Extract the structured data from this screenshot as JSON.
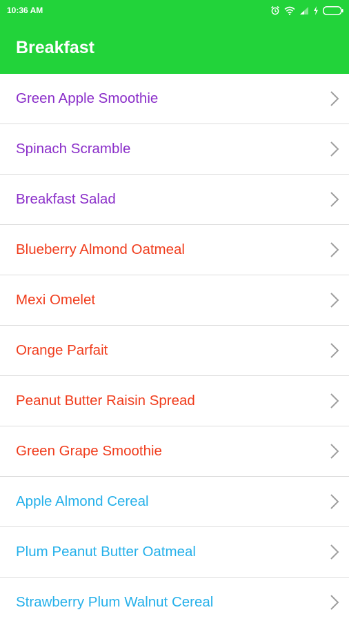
{
  "status_bar": {
    "time": "10:36 AM",
    "icons": [
      "alarm-icon",
      "wifi-icon",
      "signal-icon",
      "charging-icon",
      "battery-icon"
    ]
  },
  "app_bar": {
    "title": "Breakfast",
    "background_color": "#22d33a"
  },
  "colors": {
    "purple": "#8a2ec9",
    "red": "#f03c1c",
    "blue": "#25b0ea"
  },
  "items": [
    {
      "label": "Green Apple Smoothie",
      "color": "#8a2ec9"
    },
    {
      "label": "Spinach Scramble",
      "color": "#8a2ec9"
    },
    {
      "label": "Breakfast Salad",
      "color": "#8a2ec9"
    },
    {
      "label": "Blueberry Almond Oatmeal",
      "color": "#f03c1c"
    },
    {
      "label": "Mexi Omelet",
      "color": "#f03c1c"
    },
    {
      "label": "Orange Parfait",
      "color": "#f03c1c"
    },
    {
      "label": "Peanut Butter Raisin Spread",
      "color": "#f03c1c"
    },
    {
      "label": "Green Grape Smoothie",
      "color": "#f03c1c"
    },
    {
      "label": "Apple Almond Cereal",
      "color": "#25b0ea"
    },
    {
      "label": "Plum Peanut Butter Oatmeal",
      "color": "#25b0ea"
    },
    {
      "label": "Strawberry Plum Walnut Cereal",
      "color": "#25b0ea"
    }
  ]
}
